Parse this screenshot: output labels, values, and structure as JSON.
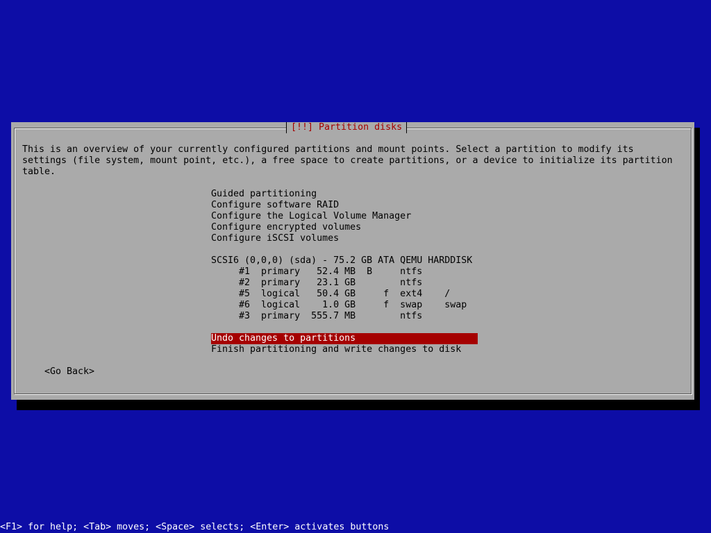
{
  "dialog": {
    "title": "[!!] Partition disks",
    "description": [
      "This is an overview of your currently configured partitions and mount points. Select a partition to modify its",
      "settings (file system, mount point, etc.), a free space to create partitions, or a device to initialize its partition",
      "table."
    ],
    "menu": {
      "guided": "Guided partitioning",
      "raid": "Configure software RAID",
      "lvm": "Configure the Logical Volume Manager",
      "encrypted": "Configure encrypted volumes",
      "iscsi": "Configure iSCSI volumes",
      "disk": "SCSI6 (0,0,0) (sda) - 75.2 GB ATA QEMU HARDDISK",
      "partitions": [
        "     #1  primary   52.4 MB  B     ntfs",
        "     #2  primary   23.1 GB        ntfs",
        "     #5  logical   50.4 GB     f  ext4    /",
        "     #6  logical    1.0 GB     f  swap    swap",
        "     #3  primary  555.7 MB        ntfs"
      ],
      "undo": "Undo changes to partitions",
      "finish": "Finish partitioning and write changes to disk"
    },
    "go_back": "<Go Back>"
  },
  "help_bar": "<F1> for help; <Tab> moves; <Space> selects; <Enter> activates buttons",
  "colors": {
    "background": "#0d0da6",
    "dialog": "#aaaaaa",
    "title_text": "#a50000",
    "highlight": "#a50000"
  }
}
